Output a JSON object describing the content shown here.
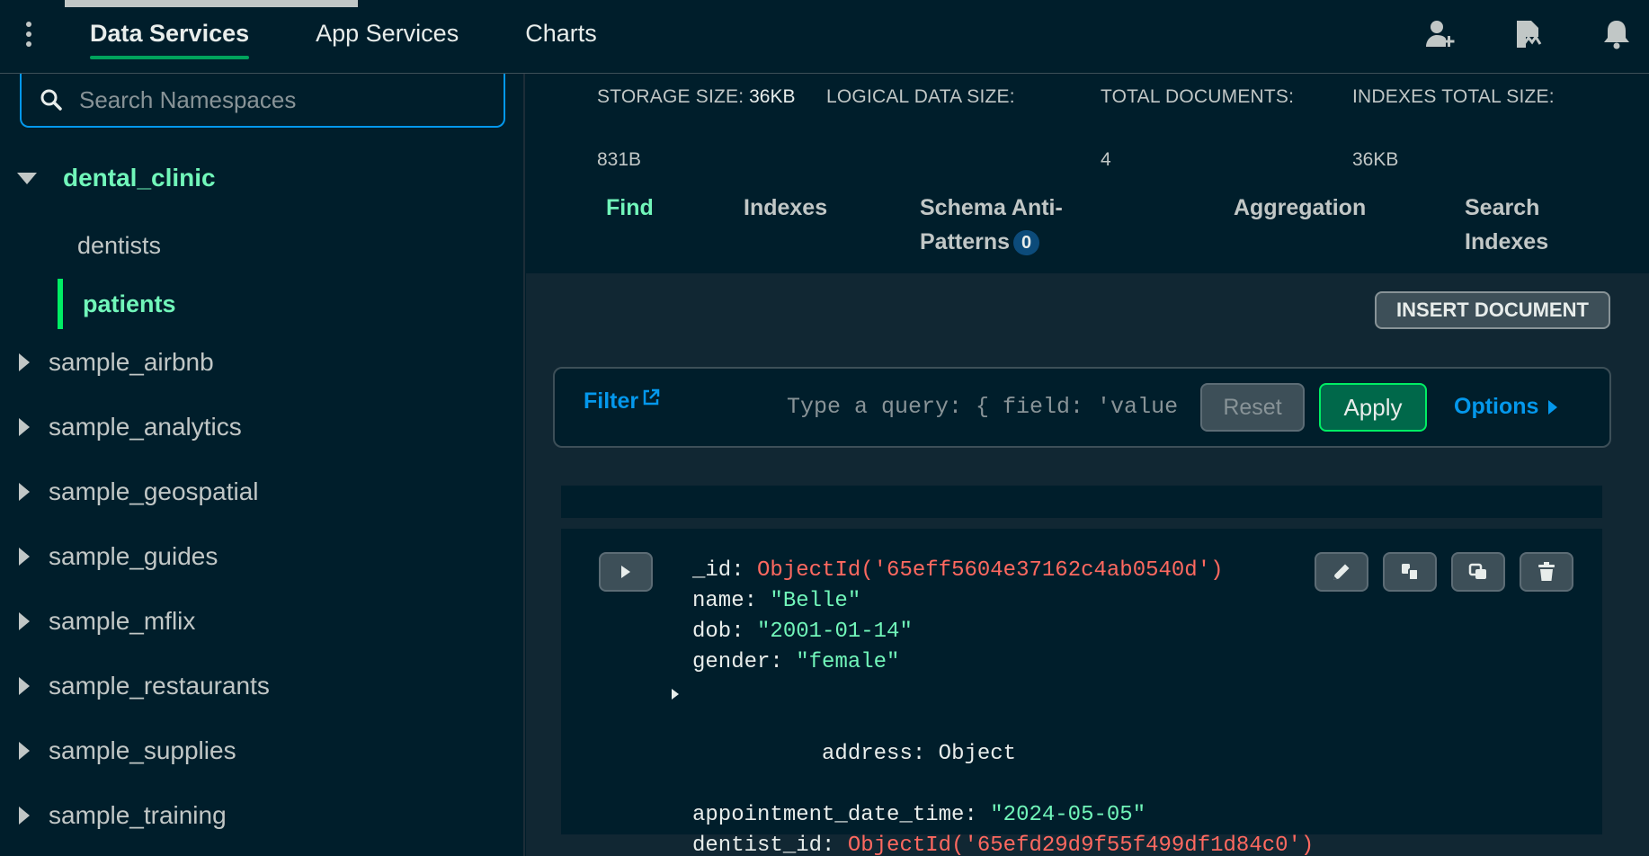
{
  "topbar": {
    "tabs": [
      {
        "label": "Data Services"
      },
      {
        "label": "App Services"
      },
      {
        "label": "Charts"
      }
    ],
    "icons": [
      "menu-kebab-icon",
      "invite-user-icon",
      "activity-feed-icon",
      "bell-icon"
    ]
  },
  "sidebar": {
    "search_placeholder": "Search Namespaces",
    "databases": [
      {
        "name": "dental_clinic",
        "expanded": true,
        "collections": [
          "dentists",
          "patients"
        ],
        "active_collection": "patients"
      },
      {
        "name": "sample_airbnb"
      },
      {
        "name": "sample_analytics"
      },
      {
        "name": "sample_geospatial"
      },
      {
        "name": "sample_guides"
      },
      {
        "name": "sample_mflix"
      },
      {
        "name": "sample_restaurants"
      },
      {
        "name": "sample_supplies"
      },
      {
        "name": "sample_training"
      }
    ]
  },
  "stats": {
    "storage_label": "STORAGE SIZE:",
    "storage_value": "36KB",
    "logical_label": "LOGICAL DATA SIZE:",
    "logical_value": "831B",
    "docs_label": "TOTAL DOCUMENTS:",
    "docs_value": "4",
    "indexes_label": "INDEXES TOTAL SIZE:",
    "indexes_value": "36KB"
  },
  "subtabs": {
    "find": "Find",
    "indexes": "Indexes",
    "schema_line1": "Schema Anti-",
    "schema_line2": "Patterns",
    "schema_badge": "0",
    "aggregation": "Aggregation",
    "search_line1": "Search",
    "search_line2": "Indexes"
  },
  "toolbar": {
    "insert_label": "INSERT DOCUMENT"
  },
  "filter": {
    "label": "Filter",
    "placeholder": "Type a query: { field: 'value' }",
    "reset_label": "Reset",
    "apply_label": "Apply",
    "options_label": "Options"
  },
  "document": {
    "fields": [
      {
        "key": "_id",
        "type": "oid",
        "value": "ObjectId('65eff5604e37162c4ab0540d')"
      },
      {
        "key": "name",
        "type": "str",
        "value": "\"Belle\""
      },
      {
        "key": "dob",
        "type": "str",
        "value": "\"2001-01-14\""
      },
      {
        "key": "gender",
        "type": "str",
        "value": "\"female\""
      },
      {
        "key": "address",
        "type": "obj",
        "value": "Object"
      },
      {
        "key": "appointment_date_time",
        "type": "str",
        "value": "\"2024-05-05\""
      },
      {
        "key": "dentist_id",
        "type": "oid",
        "value": "ObjectId('65efd29d9f55f499df1d84c0')"
      }
    ]
  },
  "colors": {
    "background": "#001e2b",
    "accent_green": "#71f6ba",
    "link_blue": "#0498ec",
    "objectid_red": "#ff6960"
  }
}
